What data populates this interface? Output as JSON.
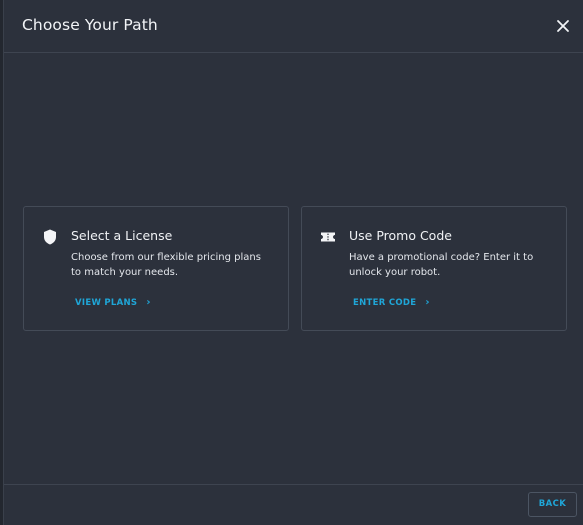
{
  "dialog": {
    "title": "Choose Your Path",
    "close_icon": "close-icon"
  },
  "options": [
    {
      "icon": "shield-icon",
      "title": "Select a License",
      "description": "Choose from our flexible pricing plans to match your needs.",
      "link_label": "VIEW PLANS",
      "link_icon": "chevron-right-icon"
    },
    {
      "icon": "ticket-icon",
      "title": "Use Promo Code",
      "description": "Have a promotional code? Enter it to unlock your robot.",
      "link_label": "ENTER CODE",
      "link_icon": "chevron-right-icon"
    }
  ],
  "footer": {
    "back_label": "BACK"
  },
  "colors": {
    "background": "#2c313c",
    "accent": "#1fa6d8",
    "text": "#f0f2f5",
    "border": "#444b57"
  }
}
